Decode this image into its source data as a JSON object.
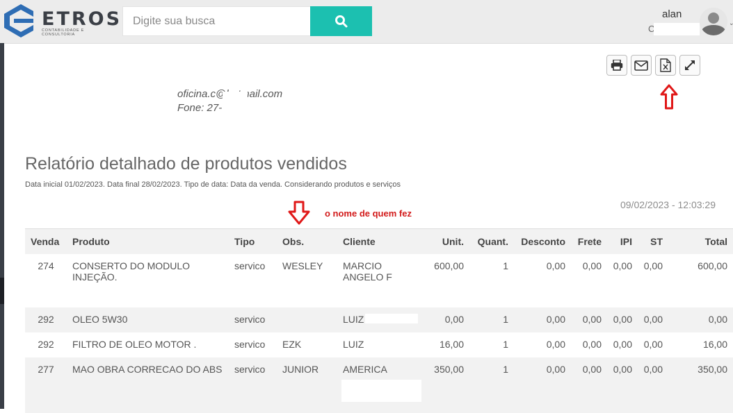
{
  "brand": {
    "name": "ETROS",
    "tagline": "CONTABILIDADE E CONSULTORIA"
  },
  "search": {
    "placeholder": "Digite sua busca"
  },
  "user": {
    "name": "alan",
    "sub": "C"
  },
  "company": {
    "line1": "",
    "email": "oficina.c@hotmail.com",
    "phone": "Fone: 27-"
  },
  "report": {
    "title": "Relatório detalhado de produtos vendidos",
    "subtitle": "Data inicial 01/02/2023. Data final 28/02/2023. Tipo de data: Data da venda. Considerando produtos e serviços",
    "datetime": "09/02/2023 - 12:03:29"
  },
  "annotation": {
    "text": "o nome de quem fez"
  },
  "table": {
    "headers": {
      "venda": "Venda",
      "produto": "Produto",
      "tipo": "Tipo",
      "obs": "Obs.",
      "cliente": "Cliente",
      "unit": "Unit.",
      "quant": "Quant.",
      "desconto": "Desconto",
      "frete": "Frete",
      "ipi": "IPI",
      "st": "ST",
      "total": "Total"
    },
    "rows": [
      {
        "venda": "274",
        "produto": "CONSERTO DO MODULO INJEÇÃO.",
        "tipo": "servico",
        "obs": "WESLEY",
        "cliente": "MARCIO ANGELO F",
        "unit": "600,00",
        "quant": "1",
        "desconto": "0,00",
        "frete": "0,00",
        "ipi": "0,00",
        "st": "0,00",
        "total": "600,00"
      },
      {
        "venda": "292",
        "produto": "OLEO 5W30",
        "tipo": "servico",
        "obs": "",
        "cliente": "LUIZ",
        "unit": "0,00",
        "quant": "1",
        "desconto": "0,00",
        "frete": "0,00",
        "ipi": "0,00",
        "st": "0,00",
        "total": "0,00"
      },
      {
        "venda": "292",
        "produto": "FILTRO DE OLEO MOTOR .",
        "tipo": "servico",
        "obs": "EZK",
        "cliente": "LUIZ",
        "unit": "16,00",
        "quant": "1",
        "desconto": "0,00",
        "frete": "0,00",
        "ipi": "0,00",
        "st": "0,00",
        "total": "16,00"
      },
      {
        "venda": "277",
        "produto": "MAO OBRA CORRECAO DO ABS",
        "tipo": "servico",
        "obs": "JUNIOR",
        "cliente": "AMERICA",
        "unit": "350,00",
        "quant": "1",
        "desconto": "0,00",
        "frete": "0,00",
        "ipi": "0,00",
        "st": "0,00",
        "total": "350,00"
      }
    ]
  },
  "colors": {
    "accent": "#1cc0b0",
    "logo_blue": "#2e6db4",
    "annotation_red": "#d21a1a"
  },
  "icons": [
    "search-icon",
    "printer-icon",
    "envelope-icon",
    "excel-icon",
    "expand-icon",
    "arrow-down-icon",
    "arrow-up-icon",
    "user-avatar-icon"
  ]
}
